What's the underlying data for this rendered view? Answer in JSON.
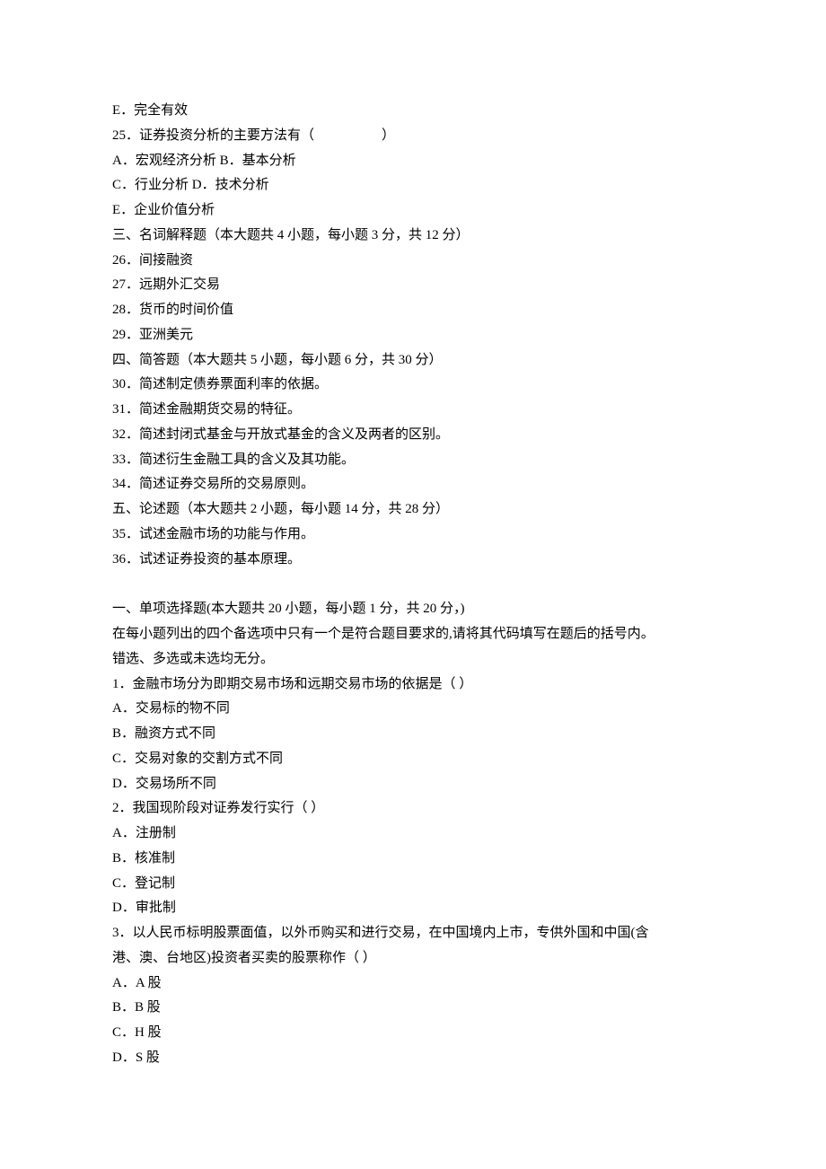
{
  "lines": {
    "l0": "E．完全有效",
    "l1": "25．证券投资分析的主要方法有（　　　　　）",
    "l2": "A．宏观经济分析 B．基本分析",
    "l3": "C．行业分析 D．技术分析",
    "l4": "E．企业价值分析",
    "l5": "三、名词解释题（本大题共 4 小题，每小题 3 分，共 12 分）",
    "l6": "26．间接融资",
    "l7": "27．远期外汇交易",
    "l8": "28．货币的时间价值",
    "l9": "29．亚洲美元",
    "l10": "四、简答题（本大题共 5 小题，每小题 6 分，共 30 分）",
    "l11": "30．简述制定债券票面利率的依据。",
    "l12": "31．简述金融期货交易的特征。",
    "l13": "32．简述封闭式基金与开放式基金的含义及两者的区别。",
    "l14": "33．简述衍生金融工具的含义及其功能。",
    "l15": "34．简述证券交易所的交易原则。",
    "l16": "五、论述题（本大题共 2 小题，每小题 14 分，共 28 分）",
    "l17": "35．试述金融市场的功能与作用。",
    "l18": "36．试述证券投资的基本原理。",
    "l19": "一、单项选择题(本大题共 20 小题，每小题 1 分，共 20 分，)",
    "l20": "在每小题列出的四个备选项中只有一个是符合题目要求的,请将其代码填写在题后的括号内。",
    "l21": "错选、多选或未选均无分。",
    "l22": "1．金融市场分为即期交易市场和远期交易市场的依据是（ ）",
    "l23": "A．交易标的物不同",
    "l24": "B．融资方式不同",
    "l25": "C．交易对象的交割方式不同",
    "l26": "D．交易场所不同",
    "l27": "2．我国现阶段对证券发行实行（ ）",
    "l28": "A．注册制",
    "l29": "B．核准制",
    "l30": "C．登记制",
    "l31": "D．审批制",
    "l32": "3．以人民币标明股票面值，以外币购买和进行交易，在中国境内上市，专供外国和中国(含",
    "l33": "港、澳、台地区)投资者买卖的股票称作（ ）",
    "l34": "A．A 股",
    "l35": "B．B 股",
    "l36": "C．H 股",
    "l37": "D．S 股"
  }
}
